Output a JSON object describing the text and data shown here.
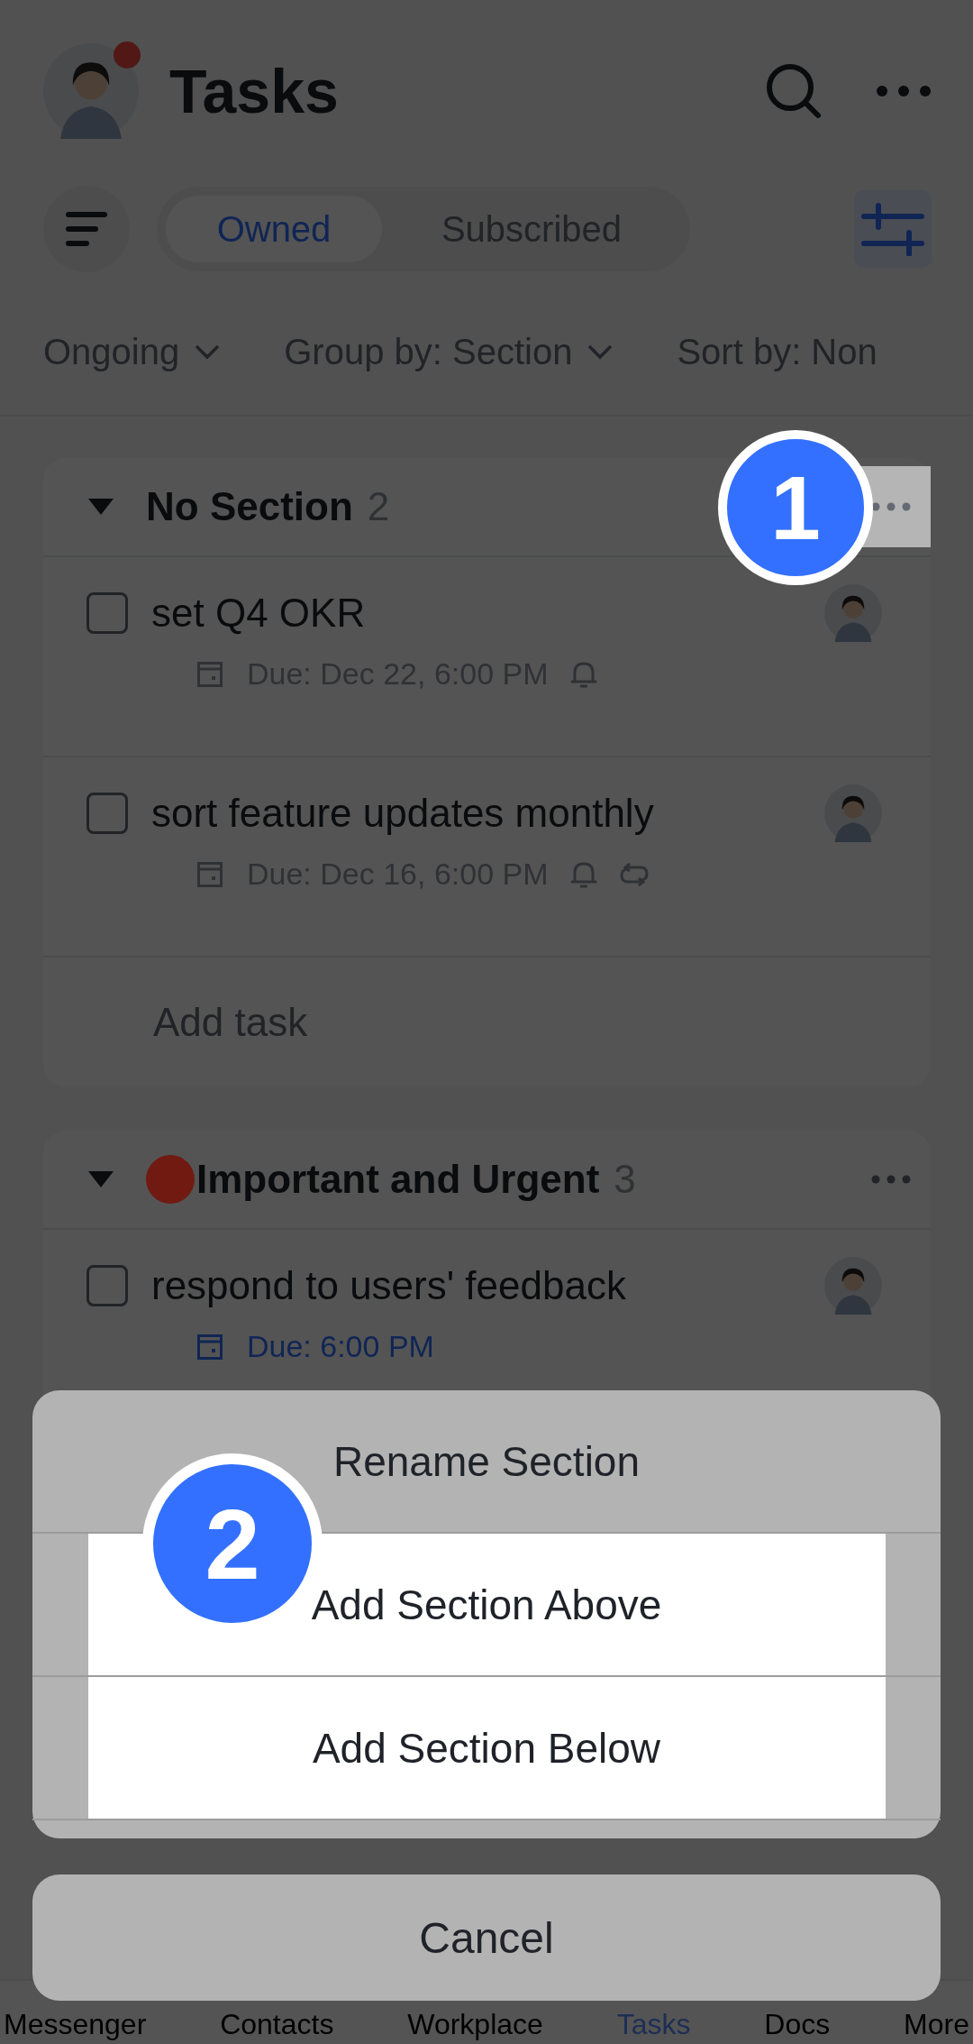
{
  "header": {
    "title": "Tasks",
    "has_notification": true
  },
  "tabs": [
    {
      "label": "Owned",
      "selected": true
    },
    {
      "label": "Subscribed",
      "selected": false
    }
  ],
  "filters": [
    "Ongoing",
    "Group by: Section",
    "Sort by: Non"
  ],
  "sections": [
    {
      "title": "No Section",
      "count": "2",
      "menu_highlighted": true,
      "tasks": [
        {
          "title": "set Q4 OKR",
          "checked": false,
          "due": "Due: Dec 22, 6:00 PM",
          "due_today": false,
          "reminder": true,
          "repeat": false
        },
        {
          "title": "sort feature updates monthly",
          "checked": false,
          "due": "Due: Dec 16, 6:00 PM",
          "due_today": false,
          "reminder": true,
          "repeat": true
        }
      ],
      "add_task": "Add task"
    },
    {
      "title": "Important and Urgent",
      "color": "#701a12",
      "count": "3",
      "menu_highlighted": false,
      "tasks": [
        {
          "title": "respond to users' feedback",
          "checked": false,
          "due": "Due: 6:00 PM",
          "due_today": true,
          "reminder": false,
          "repeat": false
        }
      ]
    }
  ],
  "action_sheet": {
    "items": [
      {
        "label": "Rename Section",
        "highlighted": false
      },
      {
        "label": "Add Section Above",
        "highlighted": true
      },
      {
        "label": "Add Section Below",
        "highlighted": true
      }
    ],
    "cancel": "Cancel"
  },
  "callouts": [
    "1",
    "2"
  ],
  "bottom_tabs": [
    {
      "label": "Messenger",
      "selected": false
    },
    {
      "label": "Contacts",
      "selected": false
    },
    {
      "label": "Workplace",
      "selected": false
    },
    {
      "label": "Tasks",
      "selected": true
    },
    {
      "label": "Docs",
      "selected": false
    },
    {
      "label": "More",
      "selected": false
    }
  ]
}
